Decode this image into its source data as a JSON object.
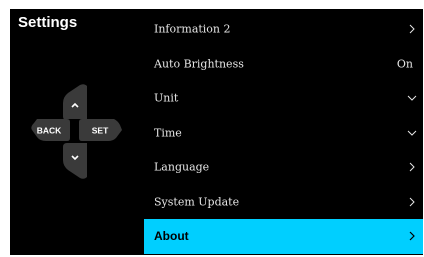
{
  "header": {
    "title": "Settings"
  },
  "dpad": {
    "back_label": "BACK",
    "set_label": "SET"
  },
  "menu": {
    "items": [
      {
        "label": "Information 2",
        "value": "",
        "indicator": "chevron-right-icon"
      },
      {
        "label": "Auto Brightness",
        "value": "On",
        "indicator": ""
      },
      {
        "label": "Unit",
        "value": "",
        "indicator": "chevron-down-icon"
      },
      {
        "label": "Time",
        "value": "",
        "indicator": "chevron-down-icon"
      },
      {
        "label": "Language",
        "value": "",
        "indicator": "chevron-right-icon"
      },
      {
        "label": "System Update",
        "value": "",
        "indicator": "chevron-right-icon"
      },
      {
        "label": "About",
        "value": "",
        "indicator": "chevron-right-icon",
        "selected": true
      }
    ]
  },
  "colors": {
    "background": "#000000",
    "highlight": "#00cfff",
    "button": "#3a3a3a",
    "text": "#e6e6e6"
  }
}
